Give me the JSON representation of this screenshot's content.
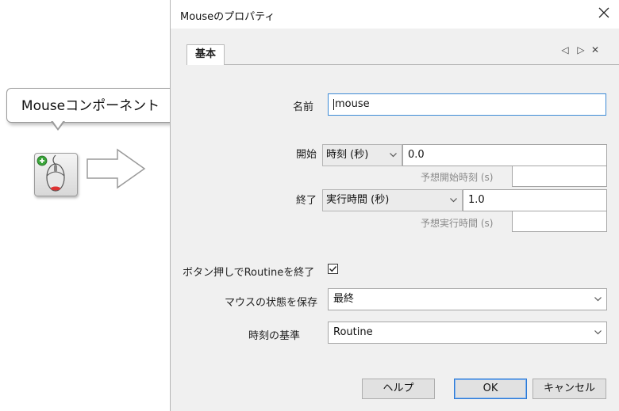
{
  "callout": {
    "text": "Mouseコンポーネント"
  },
  "dialog": {
    "title": "Mouseのプロパティ",
    "tab": "基本",
    "tab_controls": {
      "prev": "◁",
      "next": "▷",
      "close": "✕"
    },
    "fields": {
      "name": {
        "label": "名前",
        "value": "mouse"
      },
      "start": {
        "label": "開始",
        "type_value": "時刻 (秒)",
        "value": "0.0",
        "expected_label": "予想開始時刻 (s)",
        "expected_value": ""
      },
      "stop": {
        "label": "終了",
        "type_value": "実行時間 (秒)",
        "value": "1.0",
        "expected_label": "予想実行時間 (s)",
        "expected_value": ""
      },
      "force_end": {
        "label": "ボタン押しでRoutineを終了",
        "checked": true
      },
      "save_state": {
        "label": "マウスの状態を保存",
        "value": "最終"
      },
      "time_ref": {
        "label": "時刻の基準",
        "value": "Routine"
      }
    },
    "buttons": {
      "help": "ヘルプ",
      "ok": "OK",
      "cancel": "キャンセル"
    }
  },
  "colors": {
    "accent": "#3c8ad6",
    "dialog_bg": "#f0f0f0"
  }
}
